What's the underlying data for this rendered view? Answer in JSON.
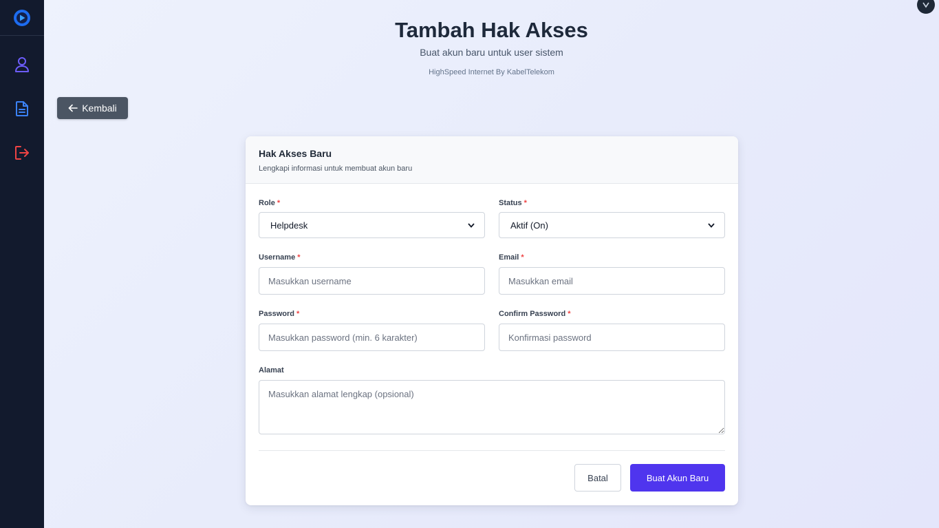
{
  "header": {
    "title": "Tambah Hak Akses",
    "subtitle": "Buat akun baru untuk user sistem",
    "brand": "HighSpeed Internet By KabelTelekom"
  },
  "back_button": {
    "label": "Kembali"
  },
  "sidebar": {
    "items": [
      {
        "name": "user",
        "icon": "user-icon",
        "color": "#6d5dfc"
      },
      {
        "name": "document",
        "icon": "document-icon",
        "color": "#3b82f6"
      },
      {
        "name": "logout",
        "icon": "logout-icon",
        "color": "#ef4444"
      }
    ]
  },
  "form": {
    "title": "Hak Akses Baru",
    "description": "Lengkapi informasi untuk membuat akun baru",
    "required_mark": "*",
    "role": {
      "label": "Role",
      "value": "Helpdesk"
    },
    "status": {
      "label": "Status",
      "value": "Aktif (On)"
    },
    "username": {
      "label": "Username",
      "placeholder": "Masukkan username"
    },
    "email": {
      "label": "Email",
      "placeholder": "Masukkan email"
    },
    "password": {
      "label": "Password",
      "placeholder": "Masukkan password (min. 6 karakter)"
    },
    "confirm_password": {
      "label": "Confirm Password",
      "placeholder": "Konfirmasi password"
    },
    "alamat": {
      "label": "Alamat",
      "placeholder": "Masukkan alamat lengkap (opsional)"
    },
    "cancel_label": "Batal",
    "submit_label": "Buat Akun Baru"
  },
  "colors": {
    "sidebar_bg": "#121a2d",
    "primary": "#4f35ee",
    "required": "#ef4444"
  }
}
